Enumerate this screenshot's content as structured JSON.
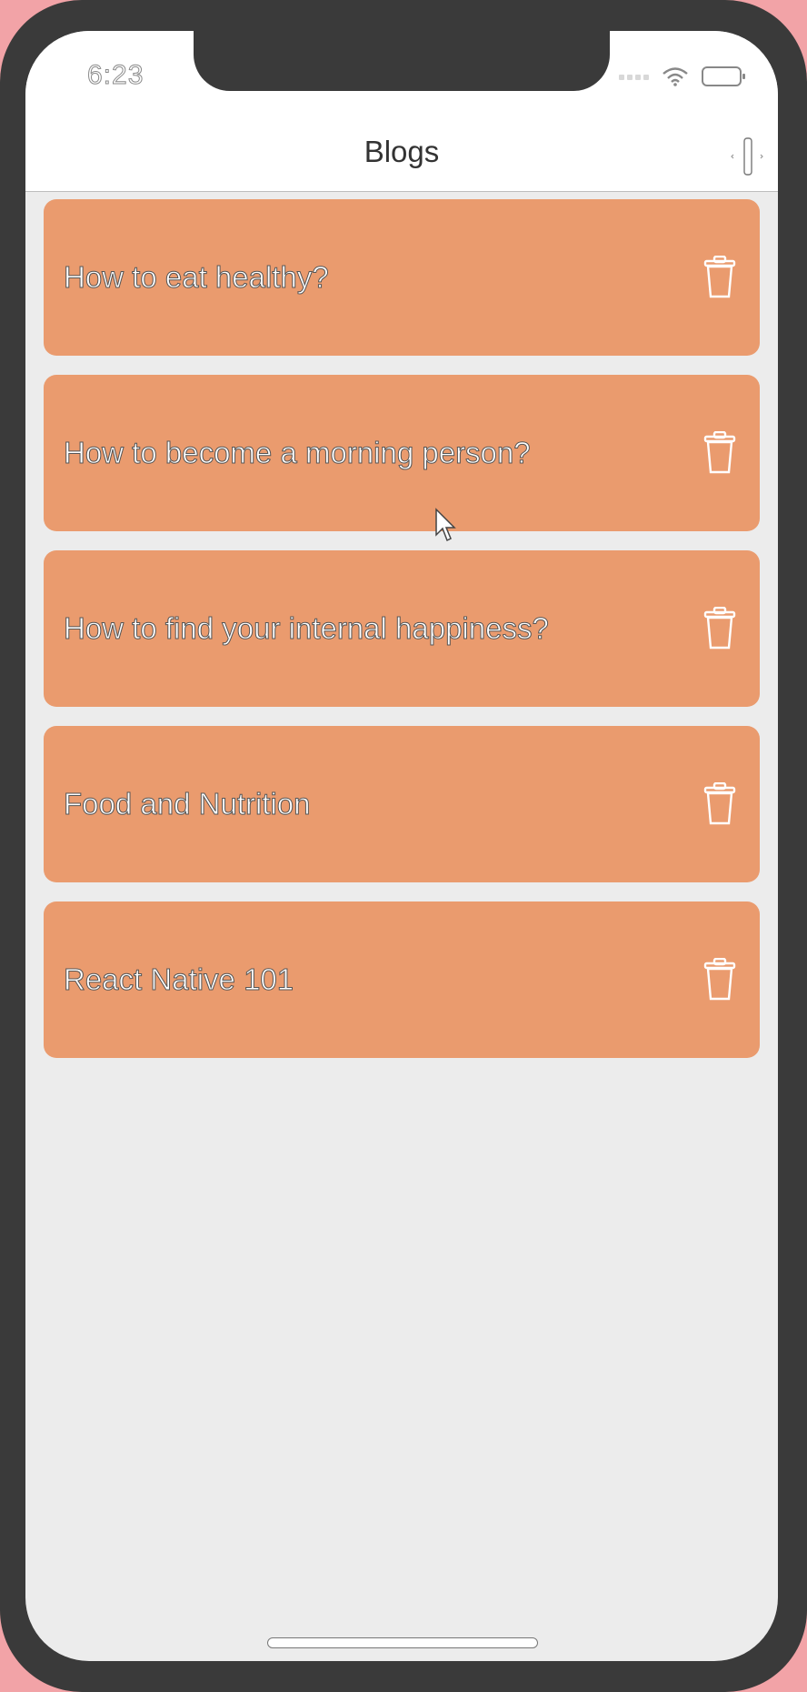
{
  "status_bar": {
    "time": "6:23",
    "icons": [
      "signal-dots",
      "wifi-icon",
      "battery-icon"
    ]
  },
  "nav": {
    "title": "Blogs",
    "action_icon": "plus-icon"
  },
  "blogs": [
    {
      "title": "How to eat healthy?",
      "action_icon": "trash-icon"
    },
    {
      "title": "How to become a morning person?",
      "action_icon": "trash-icon"
    },
    {
      "title": "How to find your internal happiness?",
      "action_icon": "trash-icon"
    },
    {
      "title": "Food and Nutrition",
      "action_icon": "trash-icon"
    },
    {
      "title": "React Native 101",
      "action_icon": "trash-icon"
    }
  ],
  "colors": {
    "card": "#ea9b6e",
    "background": "#ececec",
    "frame": "#3a3a3a",
    "outer": "#f2a3a7",
    "header": "#ffffff"
  }
}
